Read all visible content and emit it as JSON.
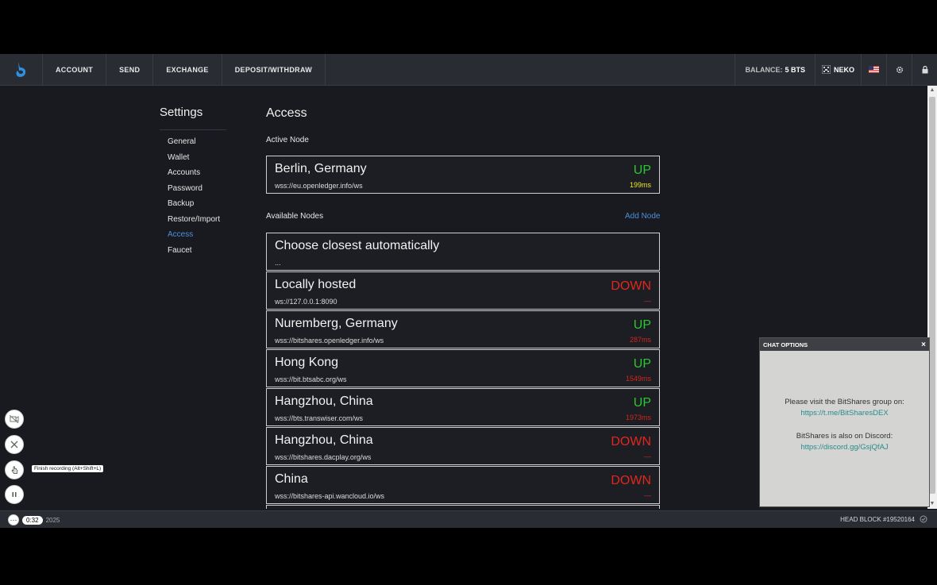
{
  "nav": {
    "items": [
      {
        "label": "ACCOUNT"
      },
      {
        "label": "SEND"
      },
      {
        "label": "EXCHANGE"
      },
      {
        "label": "DEPOSIT/WITHDRAW"
      }
    ],
    "balance_label": "BALANCE:",
    "balance_value": "5 BTS",
    "account_name": "NEKO"
  },
  "settings": {
    "title": "Settings",
    "menu": [
      "General",
      "Wallet",
      "Accounts",
      "Password",
      "Backup",
      "Restore/Import",
      "Access",
      "Faucet"
    ],
    "active": "Access"
  },
  "access": {
    "title": "Access",
    "active_node_label": "Active Node",
    "available_nodes_label": "Available Nodes",
    "add_node_label": "Add Node",
    "active_node": {
      "name": "Berlin, Germany",
      "url": "wss://eu.openledger.info/ws",
      "status": "UP",
      "ping": "199ms"
    },
    "nodes": [
      {
        "name": "Choose closest automatically",
        "url": "...",
        "status": "",
        "ping": ""
      },
      {
        "name": "Locally hosted",
        "url": "ws://127.0.0.1:8090",
        "status": "DOWN",
        "ping": "—"
      },
      {
        "name": "Nuremberg, Germany",
        "url": "wss://bitshares.openledger.info/ws",
        "status": "UP",
        "ping": "287ms"
      },
      {
        "name": "Hong Kong",
        "url": "wss://bit.btsabc.org/ws",
        "status": "UP",
        "ping": "1549ms"
      },
      {
        "name": "Hangzhou, China",
        "url": "wss://bts.transwiser.com/ws",
        "status": "UP",
        "ping": "1973ms"
      },
      {
        "name": "Hangzhou, China",
        "url": "wss://bitshares.dacplay.org/ws",
        "status": "DOWN",
        "ping": "—"
      },
      {
        "name": "China",
        "url": "wss://bitshares-api.wancloud.io/ws",
        "status": "DOWN",
        "ping": "—"
      }
    ]
  },
  "chat": {
    "header": "CHAT OPTIONS",
    "close": "×",
    "line1": "Please visit the BitShares group on:",
    "link1": "https://t.me/BitSharesDEX",
    "line2": "BitShares is also on Discord:",
    "link2": "https://discord.gg/GsjQfAJ"
  },
  "footer": {
    "head_block": "HEAD BLOCK #19520164",
    "timer": "0:32",
    "left_text": "2025"
  },
  "recording": {
    "tooltip": "Finish recording (Alt+Shift+L)"
  },
  "colors": {
    "up": "#28c832",
    "down": "#e0281e",
    "accent": "#4a90d9"
  }
}
